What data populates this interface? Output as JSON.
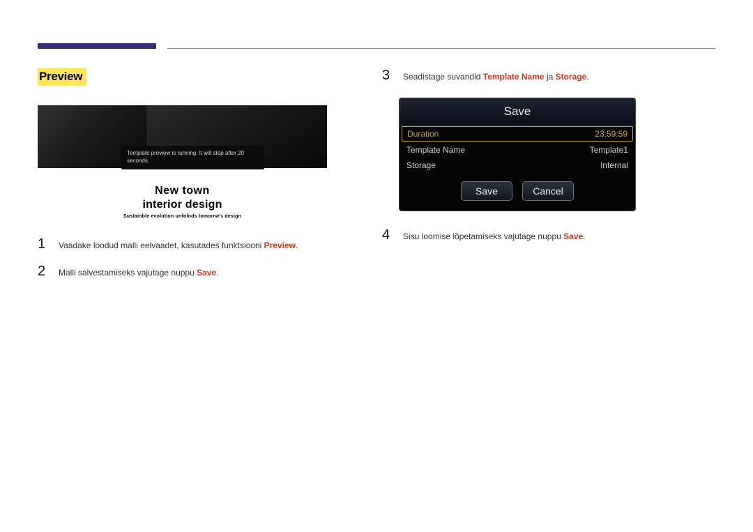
{
  "section_title": "Preview",
  "preview": {
    "toast": "Template preview is running. It will stop after 20 seconds.",
    "caption_line1": "New town",
    "caption_line2": "interior design",
    "caption_line3": "Sustainble evolution unfolods tomorrw's design"
  },
  "steps_left": [
    {
      "num": "1",
      "prefix": "Vaadake loodud malli eelvaadet, kasutades funktsiooni ",
      "hl": "Preview",
      "suffix": "."
    },
    {
      "num": "2",
      "prefix": "Malli salvestamiseks vajutage nuppu ",
      "hl": "Save",
      "suffix": "."
    }
  ],
  "steps_right": [
    {
      "num": "3",
      "prefix": "Seadistage suvandid ",
      "hl1": "Template Name",
      "mid": " ja ",
      "hl2": "Storage",
      "suffix": "."
    },
    {
      "num": "4",
      "prefix": "Sisu loomise lõpetamiseks vajutage nuppu ",
      "hl": "Save",
      "suffix": "."
    }
  ],
  "dialog": {
    "title": "Save",
    "rows": [
      {
        "label": "Duration",
        "value": "23:59:59",
        "selected": true
      },
      {
        "label": "Template Name",
        "value": "Template1",
        "selected": false
      },
      {
        "label": "Storage",
        "value": "Internal",
        "selected": false
      }
    ],
    "save_btn": "Save",
    "cancel_btn": "Cancel"
  }
}
